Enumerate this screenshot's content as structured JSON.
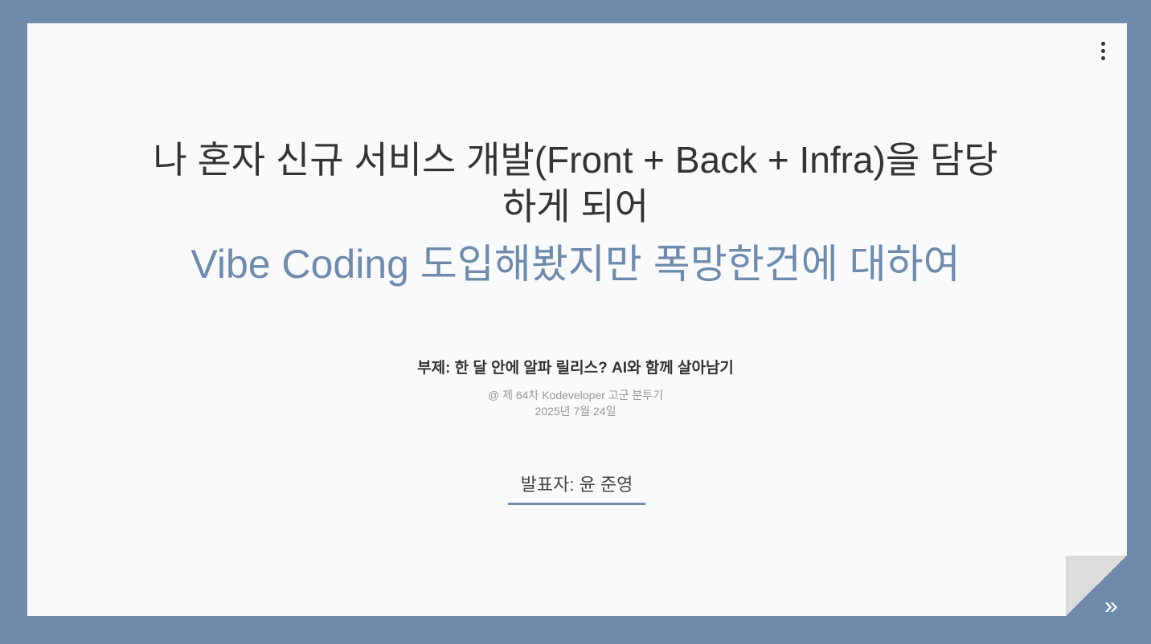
{
  "title_lines": [
    "나 혼자 신규 서비스 개발(Front + Back + Infra)을 담당",
    "하게 되어"
  ],
  "subtitle": "Vibe Coding 도입해봤지만 폭망한건에 대하여",
  "tagline": "부제: 한 달 안에 알파 릴리스? AI와 함께 살아남기",
  "event": "@ 제 64차 Kodeveloper 고군 분투기",
  "date": "2025년 7월 24일",
  "presenter": "발표자: 윤 준영",
  "controls": {
    "menu_icon": "more-vertical-icon",
    "next_icon": "double-chevron-right-icon",
    "next_glyph": "»"
  },
  "colors": {
    "background": "#6f8aab",
    "accent": "#6f8aab",
    "slide": "#f9fafb"
  }
}
